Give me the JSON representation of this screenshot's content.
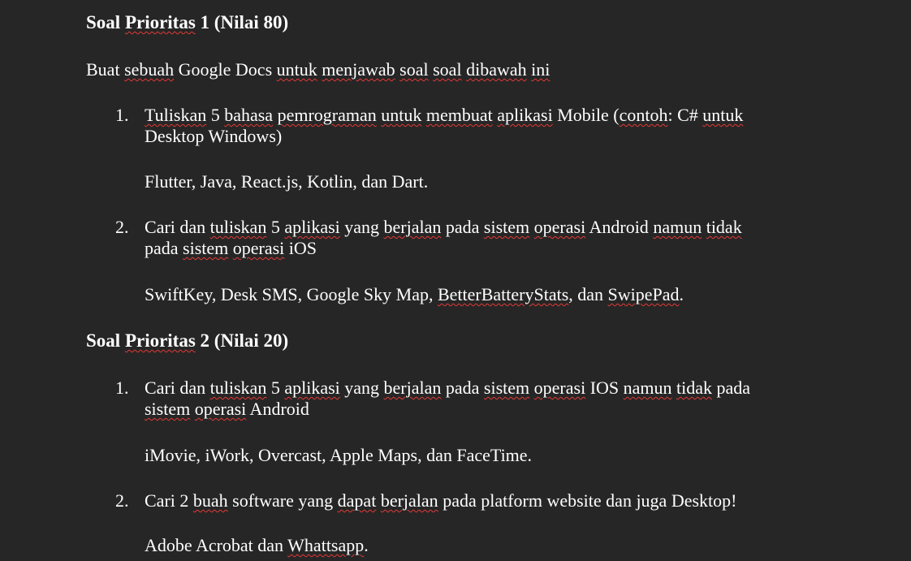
{
  "section1": {
    "heading_a": "Soal",
    "heading_b": "Prioritas",
    "heading_c": "1 (Nilai 80)"
  },
  "intro": {
    "t1": "Buat",
    "t2": "sebuah",
    "t3": "Google Docs",
    "t4": "untuk",
    "t5": "menjawab",
    "t6": "soal",
    "t7": "soal",
    "t8": "dibawah",
    "t9": "ini"
  },
  "q1": {
    "number": "1.",
    "line1": [
      {
        "t": "Tuliskan",
        "sq": true
      },
      {
        "t": " 5 ",
        "sq": false
      },
      {
        "t": "bahasa",
        "sq": true
      },
      {
        "t": " ",
        "sq": false
      },
      {
        "t": "pemrograman",
        "sq": true
      },
      {
        "t": " ",
        "sq": false
      },
      {
        "t": "untuk",
        "sq": true
      },
      {
        "t": " ",
        "sq": false
      },
      {
        "t": "membuat",
        "sq": true
      },
      {
        "t": " ",
        "sq": false
      },
      {
        "t": "aplikasi",
        "sq": true
      },
      {
        "t": " Mobile (",
        "sq": false
      },
      {
        "t": "contoh",
        "sq": true
      },
      {
        "t": ": C# ",
        "sq": false
      },
      {
        "t": "untuk",
        "sq": true
      }
    ],
    "line2": "Desktop Windows)",
    "answer": "Flutter, Java, React.js, Kotlin, dan Dart."
  },
  "q2": {
    "number": "2.",
    "line1": [
      {
        "t": "Cari dan ",
        "sq": false
      },
      {
        "t": "tuliskan",
        "sq": true
      },
      {
        "t": " 5 ",
        "sq": false
      },
      {
        "t": "aplikasi",
        "sq": true
      },
      {
        "t": " yang ",
        "sq": false
      },
      {
        "t": "berjalan",
        "sq": true
      },
      {
        "t": " pada ",
        "sq": false
      },
      {
        "t": "sistem",
        "sq": true
      },
      {
        "t": " ",
        "sq": false
      },
      {
        "t": "operasi",
        "sq": true
      },
      {
        "t": " Android ",
        "sq": false
      },
      {
        "t": "namun",
        "sq": true
      },
      {
        "t": " ",
        "sq": false
      },
      {
        "t": "tidak",
        "sq": true
      }
    ],
    "line2": [
      {
        "t": "pada ",
        "sq": false
      },
      {
        "t": "sistem",
        "sq": true
      },
      {
        "t": " ",
        "sq": false
      },
      {
        "t": "operasi",
        "sq": true
      },
      {
        "t": " iOS",
        "sq": false
      }
    ],
    "answer": [
      {
        "t": "SwiftKey, Desk SMS, Google Sky Map, ",
        "sq": false
      },
      {
        "t": "BetterBatteryStats",
        "sq": true
      },
      {
        "t": ", dan ",
        "sq": false
      },
      {
        "t": "SwipePad",
        "sq": true
      },
      {
        "t": ".",
        "sq": false
      }
    ]
  },
  "section2": {
    "heading_a": "Soal",
    "heading_b": "Prioritas",
    "heading_c": "2 (Nilai 20)"
  },
  "q3": {
    "number": "1.",
    "line1": [
      {
        "t": "Cari dan ",
        "sq": false
      },
      {
        "t": "tuliskan",
        "sq": true
      },
      {
        "t": " 5 ",
        "sq": false
      },
      {
        "t": "aplikasi",
        "sq": true
      },
      {
        "t": " yang ",
        "sq": false
      },
      {
        "t": "berjalan",
        "sq": true
      },
      {
        "t": " pada ",
        "sq": false
      },
      {
        "t": "sistem",
        "sq": true
      },
      {
        "t": " ",
        "sq": false
      },
      {
        "t": "operasi",
        "sq": true
      },
      {
        "t": " IOS ",
        "sq": false
      },
      {
        "t": "namun",
        "sq": true
      },
      {
        "t": " ",
        "sq": false
      },
      {
        "t": "tidak",
        "sq": true
      },
      {
        "t": " pada",
        "sq": false
      }
    ],
    "line2": [
      {
        "t": "sistem",
        "sq": true
      },
      {
        "t": " ",
        "sq": false
      },
      {
        "t": "operasi",
        "sq": true
      },
      {
        "t": " Android",
        "sq": false
      }
    ],
    "answer": "iMovie, iWork, Overcast, Apple Maps, dan FaceTime."
  },
  "q4": {
    "number": "2.",
    "line1": [
      {
        "t": "Cari 2 ",
        "sq": false
      },
      {
        "t": "buah",
        "sq": true
      },
      {
        "t": " software yang ",
        "sq": false
      },
      {
        "t": "dapat",
        "sq": true
      },
      {
        "t": " ",
        "sq": false
      },
      {
        "t": "berjalan",
        "sq": true
      },
      {
        "t": " pada platform website dan juga Desktop!",
        "sq": false
      }
    ],
    "answer": [
      {
        "t": "Adobe Acrobat dan ",
        "sq": false
      },
      {
        "t": "Whattsapp",
        "sq": true
      },
      {
        "t": ".",
        "sq": false
      }
    ]
  }
}
